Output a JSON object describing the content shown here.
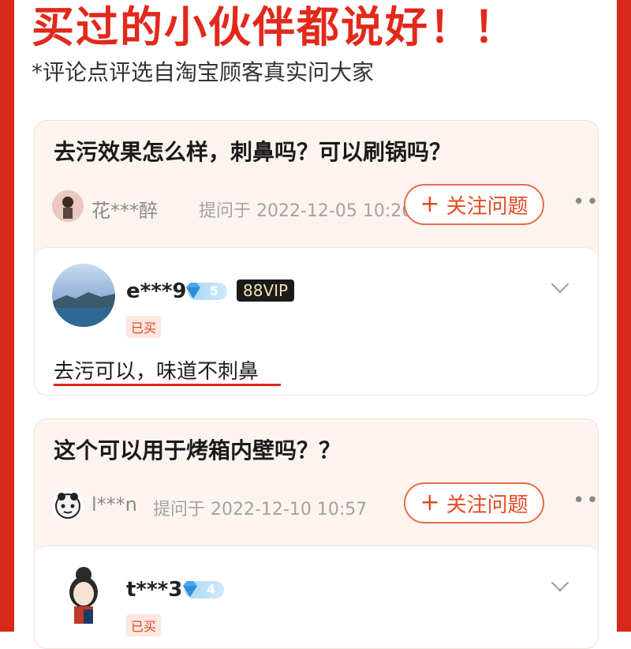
{
  "header": {
    "headline": "买过的小伙伴都说好！！",
    "subnote": "*评论点评选自淘宝顾客真实问大家"
  },
  "threads": [
    {
      "question": "去污效果怎么样，刺鼻吗？可以刷锅吗？",
      "asker": "花***醉",
      "asked_at": "提问于 2022-12-05 10:26",
      "follow_label": "关注问题",
      "answer": {
        "user": "e***9",
        "level": "5",
        "vip": "88VIP",
        "bought": "已买",
        "text": "去污可以，味道不刺鼻"
      }
    },
    {
      "question": "这个可以用于烤箱内壁吗？？",
      "asker": "l***n",
      "asked_at": "提问于 2022-12-10 10:57",
      "follow_label": "关注问题",
      "answer": {
        "user": "t***3",
        "level": "4",
        "bought": "已买"
      }
    }
  ],
  "colors": {
    "frame": "#d8281b",
    "headline": "#e1291c",
    "accent": "#e86b46"
  },
  "icons": [
    "plus-icon",
    "more-icon",
    "chevron-down-icon",
    "diamond-icon",
    "avatar"
  ]
}
